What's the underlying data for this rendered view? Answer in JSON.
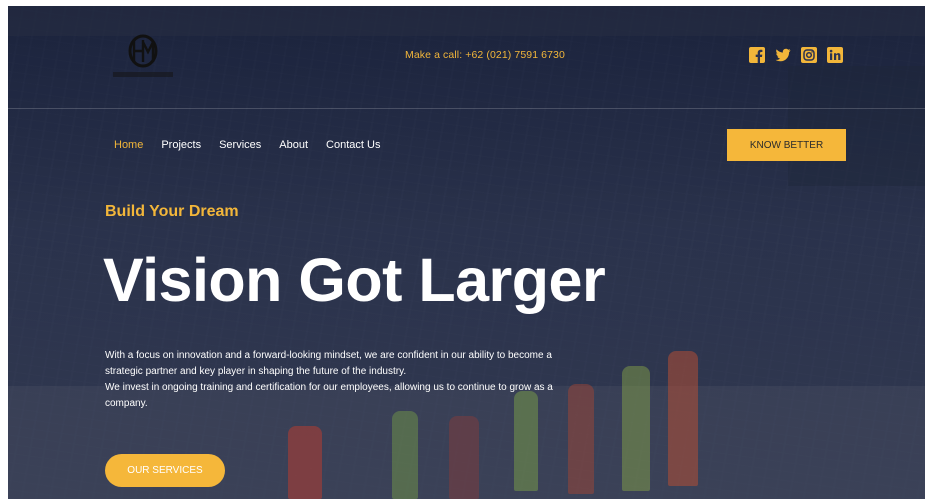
{
  "header": {
    "call_text": "Make a call: +62 (021) 7591 6730",
    "socials": [
      {
        "icon": "facebook-icon"
      },
      {
        "icon": "twitter-icon"
      },
      {
        "icon": "instagram-icon"
      },
      {
        "icon": "linkedin-icon"
      }
    ],
    "accent_color": "#f2b63a"
  },
  "nav": {
    "items": [
      {
        "label": "Home",
        "active": true
      },
      {
        "label": "Projects",
        "active": false
      },
      {
        "label": "Services",
        "active": false
      },
      {
        "label": "About",
        "active": false
      },
      {
        "label": "Contact Us",
        "active": false
      }
    ],
    "cta_label": "KNOW BETTER"
  },
  "hero": {
    "tagline": "Build Your Dream",
    "headline": "Vision Got Larger",
    "paragraph_1": "With a focus on innovation and a forward-looking mindset, we are confident in our ability to become a strategic partner and key player in shaping the future of the industry.",
    "paragraph_2": "We invest in ongoing training and certification for our employees, allowing us to continue to grow as a company.",
    "button_label": "OUR SERVICES"
  }
}
